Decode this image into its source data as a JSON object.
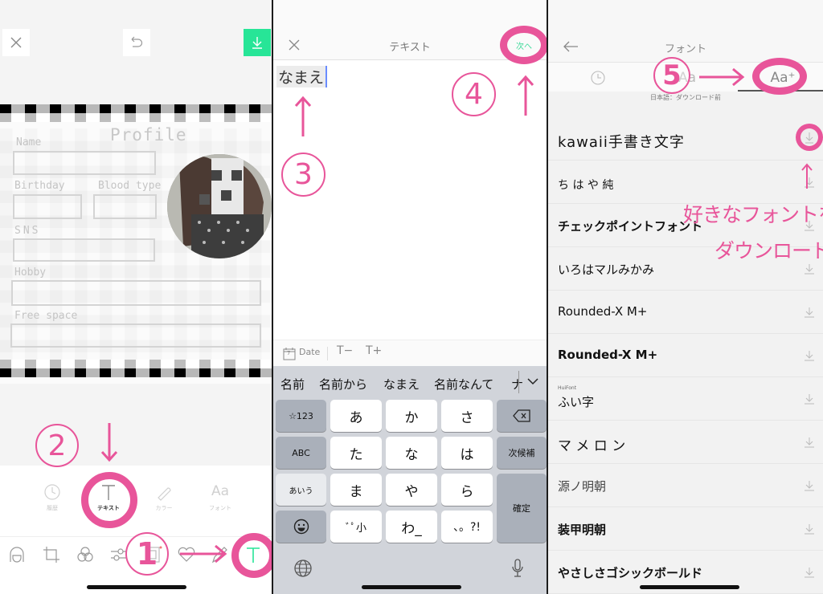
{
  "colors": {
    "accent_green": "#27e597",
    "annotation_pink": "#e8559a",
    "keyboard_bg": "#d1d4da"
  },
  "panel1": {
    "toolbar": {
      "close_icon": "close-icon",
      "undo_icon": "undo-icon",
      "save_icon": "download-icon"
    },
    "template": {
      "title": "Profile",
      "fields": [
        "Name",
        "Birthday",
        "Blood type",
        "SNS",
        "Hobby",
        "Free space"
      ]
    },
    "edit_tools": [
      {
        "icon": "clock-icon",
        "label": "履歴"
      },
      {
        "icon": "text-icon",
        "label": "テキスト"
      },
      {
        "icon": "brush-icon",
        "label": "カラー"
      },
      {
        "icon": "font-icon",
        "label": "フォント"
      }
    ],
    "bottom_icons": [
      "face-icon",
      "crop-icon",
      "filter-icon",
      "adjust-icon",
      "frame-icon",
      "heart-icon",
      "pen-icon",
      "text-icon"
    ],
    "annotations": {
      "step1": "1",
      "step2": "2"
    }
  },
  "panel2": {
    "header": {
      "title": "テキスト",
      "next_label": "次へ"
    },
    "input_value": "なまえ",
    "accessory": {
      "date_label": "Date",
      "date_day": "7",
      "smaller": "T−",
      "larger": "T+"
    },
    "candidates": [
      "名前",
      "名前から",
      "なまえ",
      "名前なんて",
      "ナ"
    ],
    "keys": {
      "row1": [
        "☆123",
        "あ",
        "か",
        "さ"
      ],
      "row2": [
        "ABC",
        "た",
        "な",
        "は",
        "次候補"
      ],
      "row3": [
        "あいう",
        "ま",
        "や",
        "ら",
        "確定"
      ],
      "row4": [
        "ﾞﾟ小",
        "わ_",
        "、。?!"
      ]
    },
    "annotations": {
      "step3": "3",
      "step4": "4"
    }
  },
  "panel3": {
    "header": {
      "title": "フォント"
    },
    "tabs": [
      {
        "icon": "clock-icon"
      },
      {
        "label": "Aa"
      },
      {
        "label": "Aa⁺"
      }
    ],
    "filter": "日本語：ダウンロード前",
    "fonts": [
      "kawaii手書き文字",
      "ち は や 純",
      "チェックポイントフォント",
      "いろはマルみかみ",
      "Rounded-X M+",
      "Rounded-X M+",
      "ふい字",
      "マ メ ロ ン",
      "源ノ明朝",
      "装甲明朝",
      "やさしさゴシックボールド"
    ],
    "font_sublabel": "HuiFont",
    "annotation_text": [
      "好きなフォントを",
      "ダウンロード"
    ],
    "annotations": {
      "step5": "5"
    }
  }
}
